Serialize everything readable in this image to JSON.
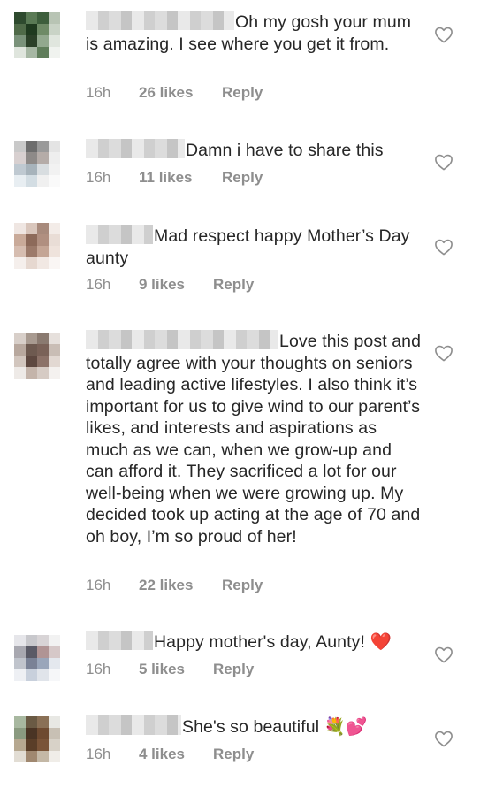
{
  "comments": [
    {
      "text": "Oh my gosh your mum is amazing. I see where you get it from.",
      "time": "16h",
      "likes": "26 likes",
      "reply": "Reply",
      "avatar_colors": [
        "#2e4a2e",
        "#5a7a55",
        "#3d5e3c",
        "#b8c4b4",
        "#4f6a48",
        "#1f3a1f",
        "#6e8a66",
        "#c9d3c6",
        "#7a927a",
        "#2b4028",
        "#92a88e",
        "#e0e6de",
        "#dfe5dd",
        "#a6b7a3",
        "#5f7d5a",
        "#f0f3ef"
      ]
    },
    {
      "text": "Damn i have to share this",
      "time": "16h",
      "likes": "11 likes",
      "reply": "Reply",
      "avatar_colors": [
        "#c9c9c9",
        "#6d6d6d",
        "#9a9a9a",
        "#e4e4e4",
        "#d8d0d0",
        "#8e8a88",
        "#b5aca8",
        "#eeeeee",
        "#bfc9d1",
        "#a7b3bb",
        "#d8dde0",
        "#f2f2f2",
        "#e8eef2",
        "#d3dde3",
        "#f0f0f0",
        "#fafafa"
      ]
    },
    {
      "text": "Mad respect happy Mother’s Day aunty",
      "time": "16h",
      "likes": "9 likes",
      "reply": "Reply",
      "avatar_colors": [
        "#efe6e2",
        "#d9c6bc",
        "#a88a7c",
        "#f3ece8",
        "#c9aa99",
        "#8d6a5a",
        "#b08f80",
        "#e9ddd6",
        "#d6bdb0",
        "#9c7a6a",
        "#c4a595",
        "#efe3dc",
        "#f5efec",
        "#e6d8d0",
        "#f1e8e3",
        "#faf6f4"
      ]
    },
    {
      "text": "Love this post and totally agree with your thoughts on seniors and leading active lifestyles. I also think it’s important for us to give wind to our parent’s likes, and interests and aspirations as much as we can, when we grow-up and can afford it. They sacrificed a lot for our well-being when we were growing up. My decided took up acting at the age of 70 and oh boy, I’m so proud of her!",
      "time": "16h",
      "likes": "22 likes",
      "reply": "Reply",
      "avatar_colors": [
        "#d8cfc9",
        "#a89a90",
        "#8a7a70",
        "#e6e0dc",
        "#b8a89e",
        "#6e5a50",
        "#7a6258",
        "#c9bdb5",
        "#d2c6be",
        "#5e4840",
        "#8c7268",
        "#e2d8d2",
        "#eeeae7",
        "#c4b4aa",
        "#d6cbc4",
        "#f4f1ef"
      ]
    },
    {
      "text": "Happy mother's day, Aunty! ❤️",
      "time": "16h",
      "likes": "5 likes",
      "reply": "Reply",
      "avatar_colors": [
        "#e6e6ea",
        "#c8c8cc",
        "#d8d4d6",
        "#f2f2f2",
        "#a8a8b0",
        "#5a5a66",
        "#b09494",
        "#d6c8c8",
        "#c0c4cc",
        "#7a8296",
        "#9aa6ba",
        "#e4e8ee",
        "#eef0f4",
        "#c8d0dc",
        "#e0e4ea",
        "#f6f7f9"
      ]
    },
    {
      "text": "She's so beautiful 💐💕",
      "time": "16h",
      "likes": "4 likes",
      "reply": "Reply",
      "avatar_colors": [
        "#a8b8a0",
        "#6a5a44",
        "#8a7056",
        "#e8e8e4",
        "#8a9a80",
        "#4a3424",
        "#6e4a30",
        "#c8c0b4",
        "#b6a890",
        "#5a3e28",
        "#7a5438",
        "#d8d2c8",
        "#e2ddd4",
        "#a08870",
        "#c4b8a6",
        "#f0ede8"
      ]
    }
  ],
  "colors": {
    "text": "#262626",
    "meta": "#8e8e8e",
    "heart_emoji": "#e0102a"
  },
  "icons": {
    "heart_outline": "heart-icon",
    "emoji_heart": "red-heart-emoji",
    "emoji_bouquet": "bouquet-emoji",
    "emoji_two_hearts": "two-hearts-emoji"
  }
}
